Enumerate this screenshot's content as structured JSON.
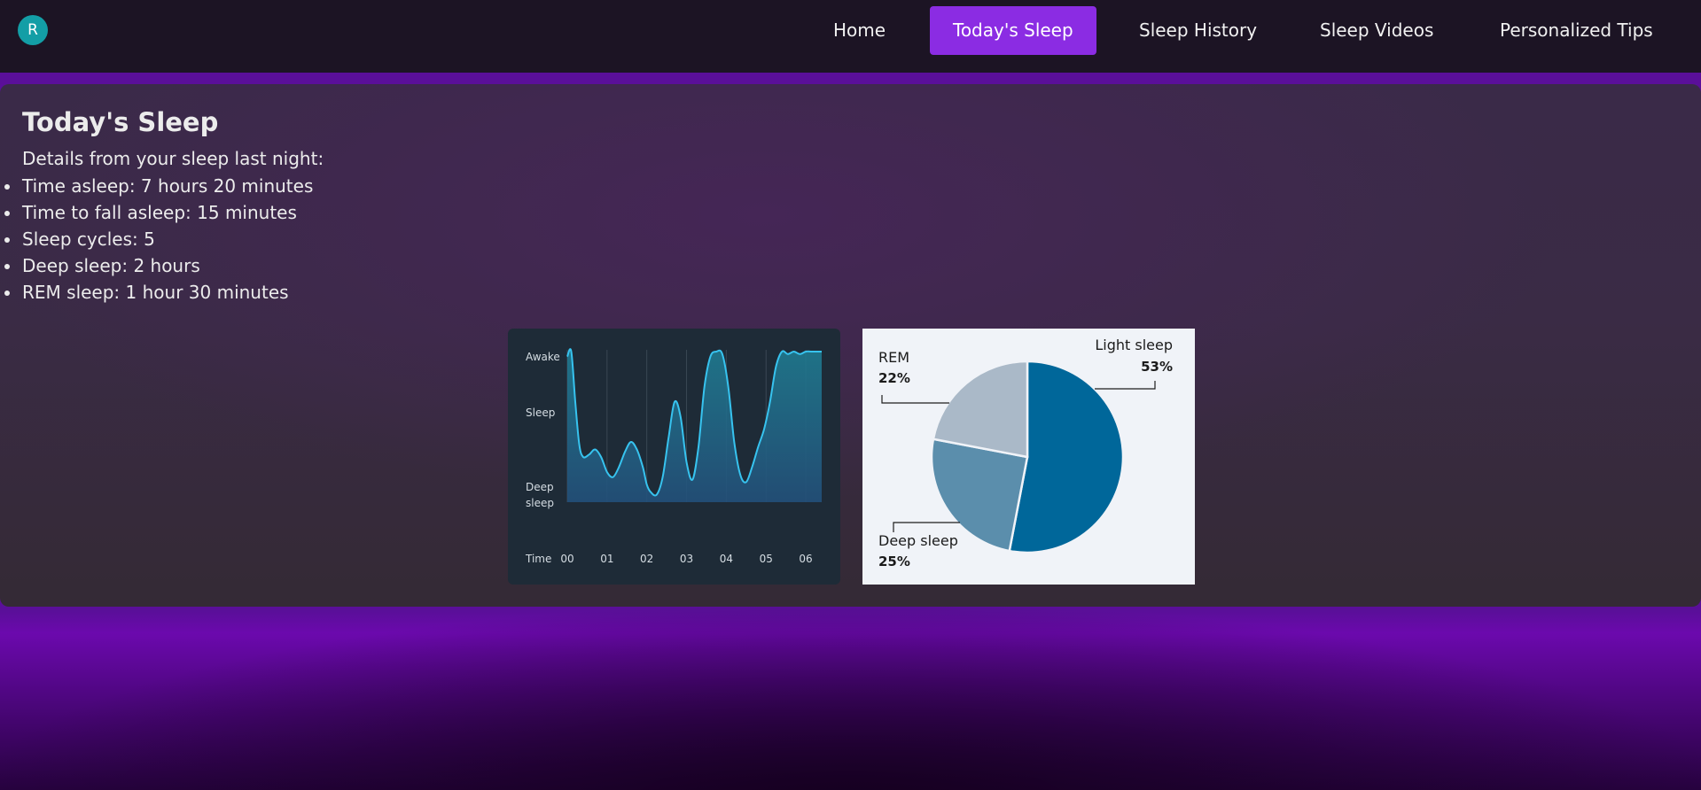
{
  "header": {
    "avatar_letter": "R",
    "nav": [
      {
        "label": "Home",
        "active": false
      },
      {
        "label": "Today's Sleep",
        "active": true
      },
      {
        "label": "Sleep History",
        "active": false
      },
      {
        "label": "Sleep Videos",
        "active": false
      },
      {
        "label": "Personalized Tips",
        "active": false
      }
    ]
  },
  "main": {
    "title": "Today's Sleep",
    "intro": "Details from your sleep last night:",
    "details": [
      "Time asleep: 7 hours 20 minutes",
      "Time to fall asleep: 15 minutes",
      "Sleep cycles: 5",
      "Deep sleep: 2 hours",
      "REM sleep: 1 hour 30 minutes"
    ]
  },
  "colors": {
    "nav_active": "#8b2ce3",
    "avatar": "#139ea6",
    "hypnogram_line": "#37c3ef",
    "pie_light": "#00679a",
    "pie_deep": "#5b8eac",
    "pie_rem": "#aab9c8"
  },
  "chart_data": [
    {
      "type": "line",
      "y_levels": [
        "Awake",
        "Sleep",
        "Deep sleep"
      ],
      "xlabel": "Time",
      "categories": [
        "00",
        "01",
        "02",
        "03",
        "04",
        "05",
        "06"
      ],
      "x": [
        0,
        0.1,
        0.2,
        0.3,
        0.4,
        0.55,
        0.7,
        0.85,
        1.0,
        1.15,
        1.3,
        1.45,
        1.6,
        1.75,
        1.9,
        2.0,
        2.1,
        2.25,
        2.4,
        2.55,
        2.7,
        2.85,
        3.0,
        3.15,
        3.3,
        3.45,
        3.6,
        3.75,
        3.9,
        4.05,
        4.2,
        4.35,
        4.5,
        4.65,
        4.8,
        4.95,
        5.1,
        5.25,
        5.4,
        5.55,
        5.7,
        5.85,
        6.0,
        6.15,
        6.3,
        6.4
      ],
      "values": [
        2.9,
        3.0,
        2.0,
        1.15,
        0.9,
        0.95,
        1.05,
        0.9,
        0.6,
        0.5,
        0.7,
        1.0,
        1.2,
        1.05,
        0.7,
        0.35,
        0.2,
        0.15,
        0.5,
        1.3,
        2.0,
        1.7,
        0.8,
        0.45,
        1.1,
        2.3,
        2.9,
        3.0,
        2.95,
        2.3,
        1.2,
        0.55,
        0.4,
        0.7,
        1.1,
        1.45,
        2.0,
        2.7,
        3.0,
        2.95,
        3.0,
        2.95,
        3.0,
        3.0,
        3.0,
        3.0
      ]
    },
    {
      "type": "pie",
      "slices": [
        {
          "label": "Light sleep",
          "value": 53,
          "pct_label": "53%"
        },
        {
          "label": "Deep sleep",
          "value": 25,
          "pct_label": "25%"
        },
        {
          "label": "REM",
          "value": 22,
          "pct_label": "22%"
        }
      ]
    }
  ]
}
